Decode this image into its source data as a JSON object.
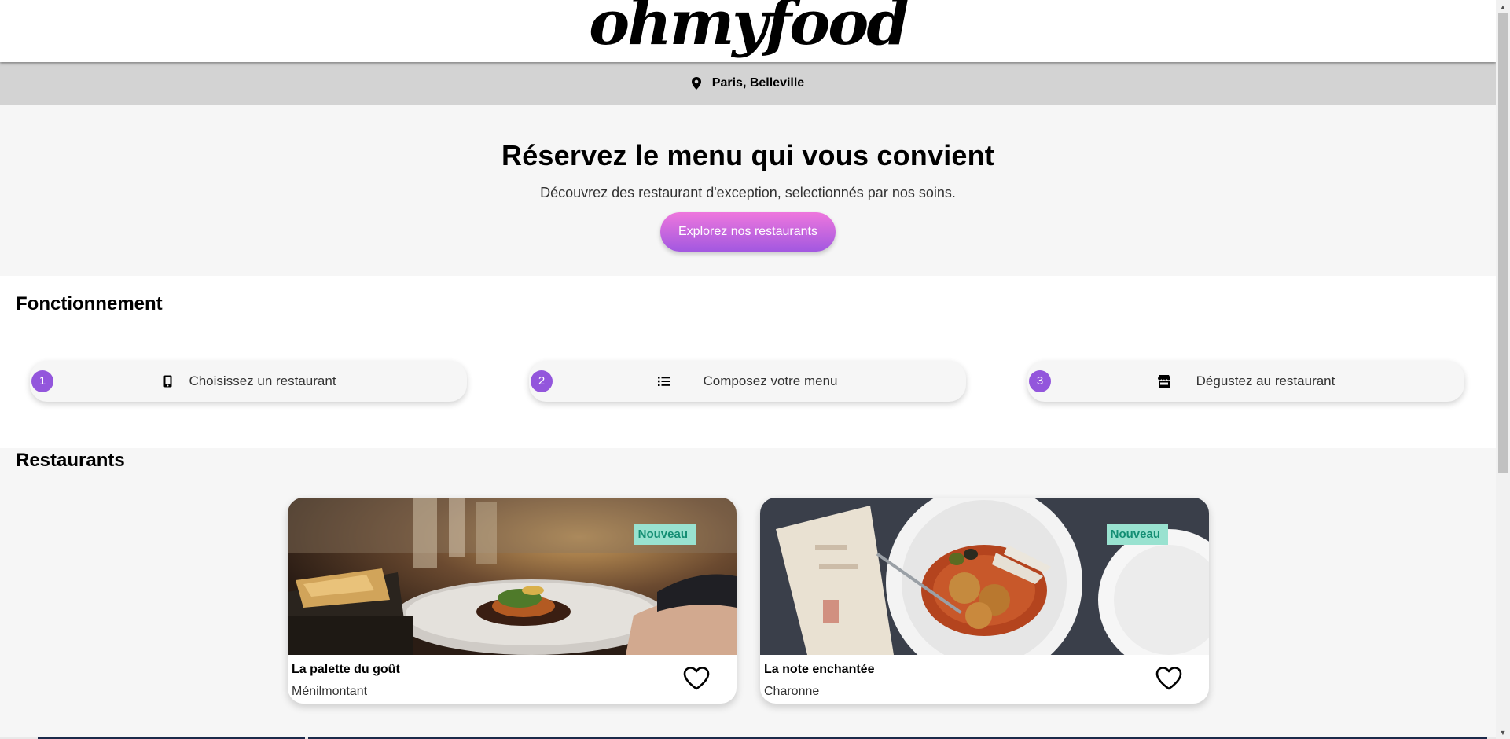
{
  "header": {
    "logo": "ohmyfood"
  },
  "location": {
    "icon": "map-pin-icon",
    "text": "Paris, Belleville"
  },
  "hero": {
    "title": "Réservez le menu qui vous convient",
    "subtitle": "Découvrez des restaurant d'exception, selectionnés par nos soins.",
    "cta_label": "Explorez nos restaurants"
  },
  "steps": {
    "title": "Fonctionnement",
    "items": [
      {
        "number": "1",
        "icon": "smartphone-icon",
        "label": "Choisissez un restaurant"
      },
      {
        "number": "2",
        "icon": "list-icon",
        "label": "Composez votre menu"
      },
      {
        "number": "3",
        "icon": "store-icon",
        "label": "Dégustez au restaurant"
      }
    ]
  },
  "restaurants": {
    "title": "Restaurants",
    "items": [
      {
        "name": "La palette du goût",
        "area": "Ménilmontant",
        "badge": "Nouveau"
      },
      {
        "name": "La note enchantée",
        "area": "Charonne",
        "badge": "Nouveau"
      }
    ]
  },
  "colors": {
    "accent_purple": "#9356dc",
    "cta_gradient_top": "#ee77dd",
    "cta_gradient_bottom": "#a258e0",
    "badge_bg": "#99e2d0",
    "badge_text": "#148e74"
  }
}
